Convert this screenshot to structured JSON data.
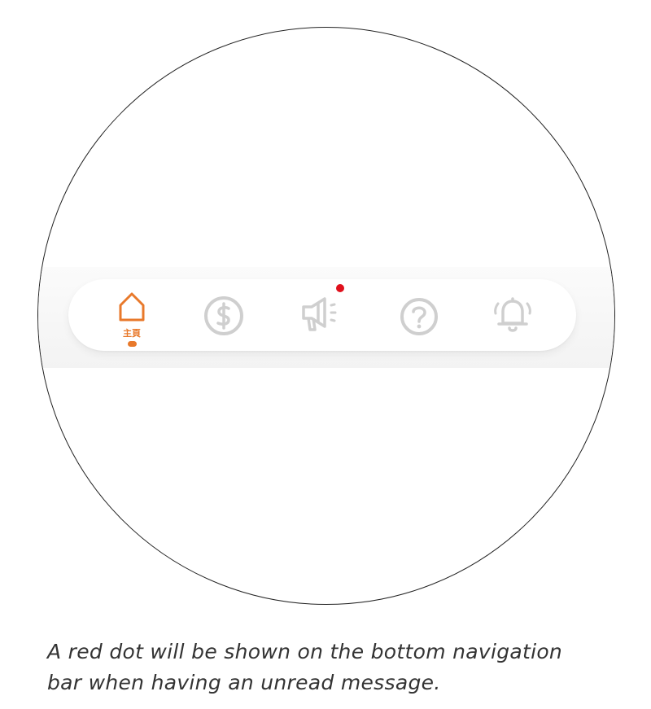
{
  "colors": {
    "active": "#E8792B",
    "inactive": "#CFCFCF",
    "badge": "#E0101C",
    "caption": "#333333"
  },
  "nav": {
    "items": [
      {
        "icon": "home-icon",
        "label": "主頁",
        "active": true
      },
      {
        "icon": "dollar-icon",
        "label": "",
        "active": false
      },
      {
        "icon": "megaphone-icon",
        "label": "",
        "active": false,
        "badge": true
      },
      {
        "icon": "help-icon",
        "label": "",
        "active": false
      },
      {
        "icon": "bell-icon",
        "label": "",
        "active": false
      }
    ]
  },
  "caption": {
    "line1": "A red dot will be shown on the bottom navigation",
    "line2": "bar when having an unread message."
  }
}
